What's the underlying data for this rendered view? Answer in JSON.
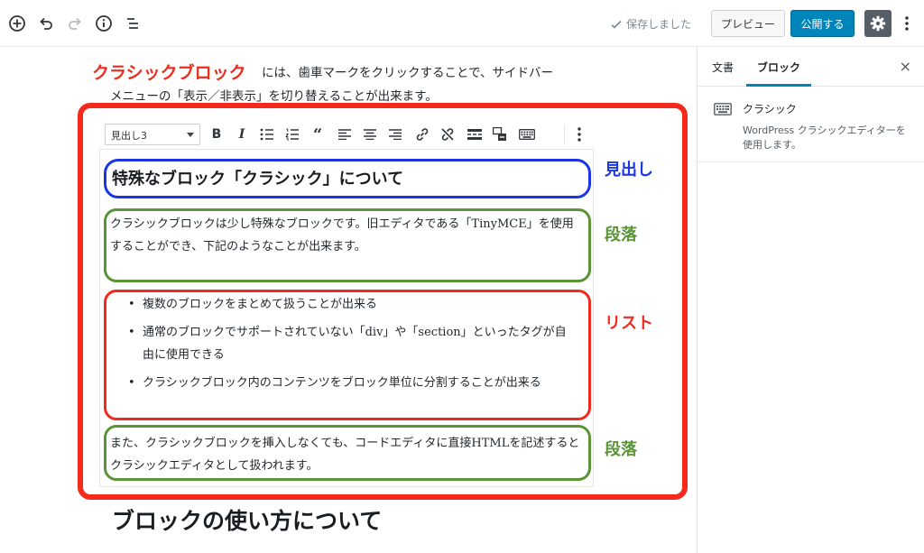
{
  "toolbar": {
    "add_icon": "plus-circle-icon",
    "undo_icon": "undo-icon",
    "redo_icon": "redo-icon",
    "info_icon": "info-icon",
    "outline_icon": "list-outline-icon",
    "saved_label": "保存しました",
    "preview_label": "プレビュー",
    "publish_label": "公開する",
    "settings_icon": "gear-icon",
    "more_icon": "vertical-ellipsis-icon",
    "colors": {
      "publish": "#0085ba",
      "settings": "#555d66"
    }
  },
  "sidebar": {
    "tabs": [
      {
        "label": "文書",
        "active": false
      },
      {
        "label": "ブロック",
        "active": true
      }
    ],
    "close_label": "×",
    "block": {
      "icon": "keyboard-icon",
      "title": "クラシック",
      "description": "WordPress クラシックエディターを使用します。"
    }
  },
  "editor": {
    "intro_line1": "には、歯車マークをクリックすることで、サイドバー",
    "intro_line2": "メニューの「表示／非表示」を切り替えることが出来ます。",
    "classic_toolbar": {
      "format_select": "見出し3",
      "buttons": [
        "bold",
        "italic",
        "bullet-list",
        "numbered-list",
        "blockquote",
        "align-left",
        "align-center",
        "align-right",
        "link",
        "unlink",
        "read-more",
        "toolbar-toggle",
        "keyboard"
      ]
    },
    "heading": "特殊なブロック「クラシック」について",
    "paragraph1": "クラシックブロックは少し特殊なブロックです。旧エディタである「TinyMCE」を使用することができ、下記のようなことが出来ます。",
    "list_items": [
      "複数のブロックをまとめて扱うことが出来る",
      "通常のブロックでサポートされていない「div」や「section」といったタグが自由に使用できる",
      "クラシックブロック内のコンテンツをブロック単位に分割することが出来る"
    ],
    "paragraph2": "また、クラシックブロックを挿入しなくても、コードエディタに直接HTMLを記述するとクラシックエディタとして扱われます。",
    "next_heading": "ブロックの使い方について"
  },
  "annotations": {
    "classic_block": "クラシックブロック",
    "heading": "見出し",
    "paragraph_1": "段落",
    "list": "リスト",
    "paragraph_2": "段落",
    "colors": {
      "red": "#f52a1c",
      "blue": "#1b35e6",
      "green": "#5a9436"
    }
  }
}
